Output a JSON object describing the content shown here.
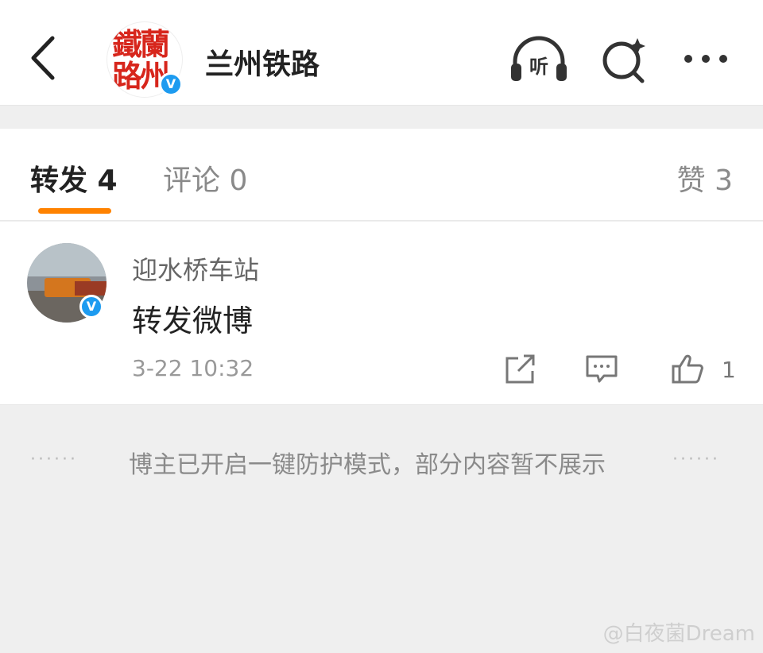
{
  "header": {
    "title": "兰州铁路",
    "avatar_seal_text": "鐵蘭路州",
    "verified_badge": "V",
    "listen_label": "听"
  },
  "tabs": {
    "repost": "转发 4",
    "comment": "评论 0",
    "like": "赞 3"
  },
  "post": {
    "username": "迎水桥车站",
    "content": "转发微博",
    "time": "3-22 10:32",
    "like_count": "1",
    "verified_badge": "V"
  },
  "notice": {
    "dots": "······",
    "text": "博主已开启一键防护模式，部分内容暂不展示"
  },
  "watermark": "@白夜菌Dream",
  "colors": {
    "accent": "#ff8200",
    "verified": "#1d9bf0",
    "seal_red": "#d7261c"
  }
}
